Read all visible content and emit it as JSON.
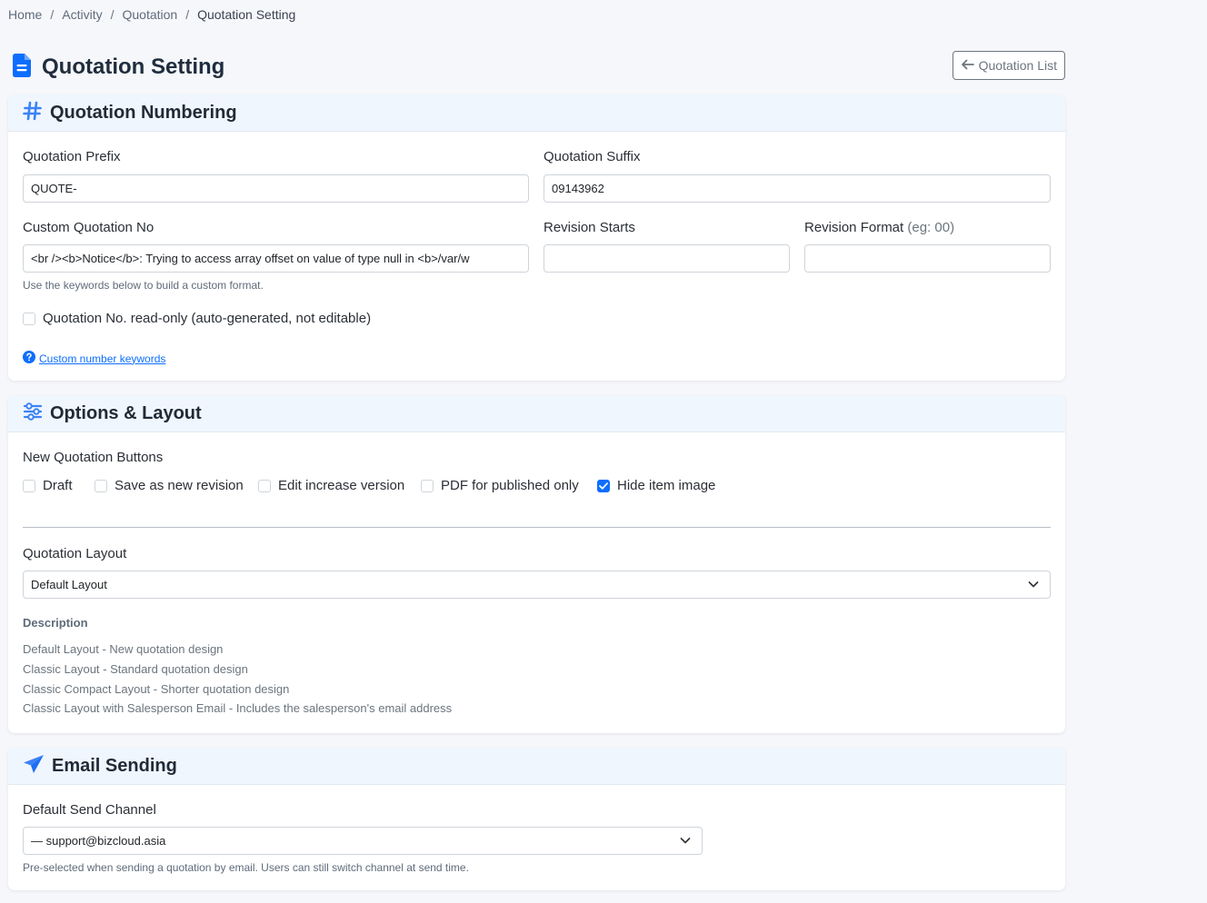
{
  "breadcrumb": [
    "Home",
    "Activity",
    "Quotation",
    "Quotation Setting"
  ],
  "page": {
    "title": "Quotation Setting",
    "back_label": "Quotation List"
  },
  "colors": {
    "accent": "#0d6efd",
    "icon_blue": "#3b82f6",
    "header_bg": "#f0f6fe"
  },
  "numbering": {
    "title": "Quotation Numbering",
    "prefix_label": "Quotation Prefix",
    "prefix_value": "QUOTE-",
    "suffix_label": "Quotation Suffix",
    "suffix_value": "09143962",
    "custom_label": "Custom Quotation No",
    "custom_value": "<br /><b>Notice</b>:  Trying to access array offset on value of type null in <b>/var/w",
    "custom_hint": "Use the keywords below to build a custom format.",
    "revision_starts_label": "Revision Starts",
    "revision_starts_value": "",
    "revision_format_label": "Revision Format",
    "revision_format_hint": "(eg: 00)",
    "revision_format_value": "",
    "readonly_label": "Quotation No. read-only (auto-generated, not editable)",
    "readonly_checked": false,
    "keywords_link": "Custom number keywords"
  },
  "options": {
    "title": "Options & Layout",
    "buttons_label": "New Quotation Buttons",
    "checkboxes": [
      {
        "label": "Draft",
        "checked": false
      },
      {
        "label": "Save as new revision",
        "checked": false
      },
      {
        "label": "Edit increase version",
        "checked": false
      },
      {
        "label": "PDF for published only",
        "checked": false
      },
      {
        "label": "Hide item image",
        "checked": true
      }
    ],
    "layout_label": "Quotation Layout",
    "layout_value": "Default Layout",
    "description_title": "Description",
    "descriptions": [
      "Default Layout - New quotation design",
      "Classic Layout - Standard quotation design",
      "Classic Compact Layout - Shorter quotation design",
      "Classic Layout with Salesperson Email - Includes the salesperson's email address"
    ]
  },
  "email": {
    "title": "Email Sending",
    "channel_label": "Default Send Channel",
    "channel_value": "— support@bizcloud.asia",
    "channel_hint": "Pre-selected when sending a quotation by email. Users can still switch channel at send time."
  }
}
